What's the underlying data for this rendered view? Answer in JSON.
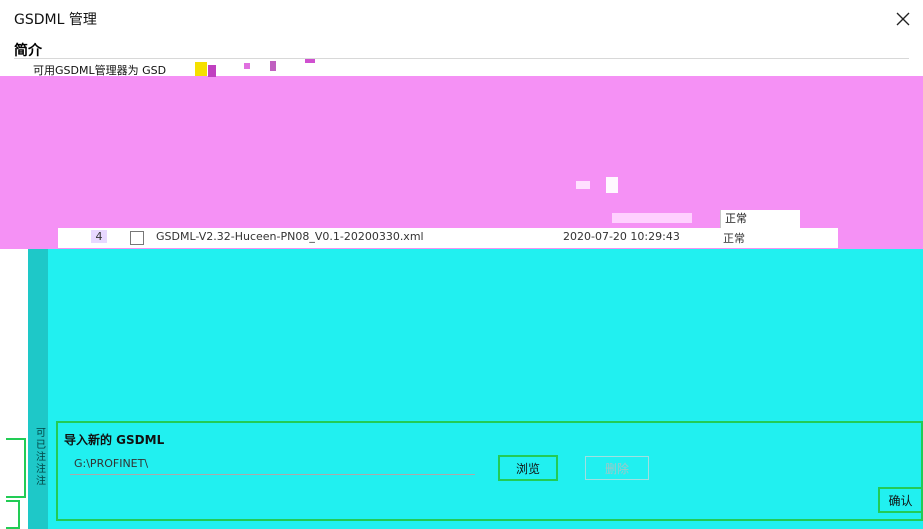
{
  "window": {
    "title": "GSDML 管理",
    "close_icon": "close-icon",
    "close_glyph": "×"
  },
  "intro": {
    "heading": "简介",
    "text_fragment": "可用GSDML管理器为 GSD"
  },
  "table": {
    "status_column_header": "正常",
    "rows": [
      {
        "index": "4",
        "checked": false,
        "filename": "GSDML-V2.32-Huceen-PN08_V0.1-20200330.xml",
        "date": "2020-07-20 10:29:43",
        "status": "正常"
      }
    ]
  },
  "import_section": {
    "heading": "导入新的 GSDML",
    "path_value": "G:\\PROFINET\\",
    "browse_label": "浏览",
    "delete_label": "删除",
    "confirm_label": "确认"
  },
  "left_labels": [
    "可",
    "已",
    "注",
    "注",
    "注"
  ],
  "colors": {
    "magenta_cover": "#f591f5",
    "cyan_cover": "#21f0f0",
    "green_outline": "#22cc55"
  }
}
